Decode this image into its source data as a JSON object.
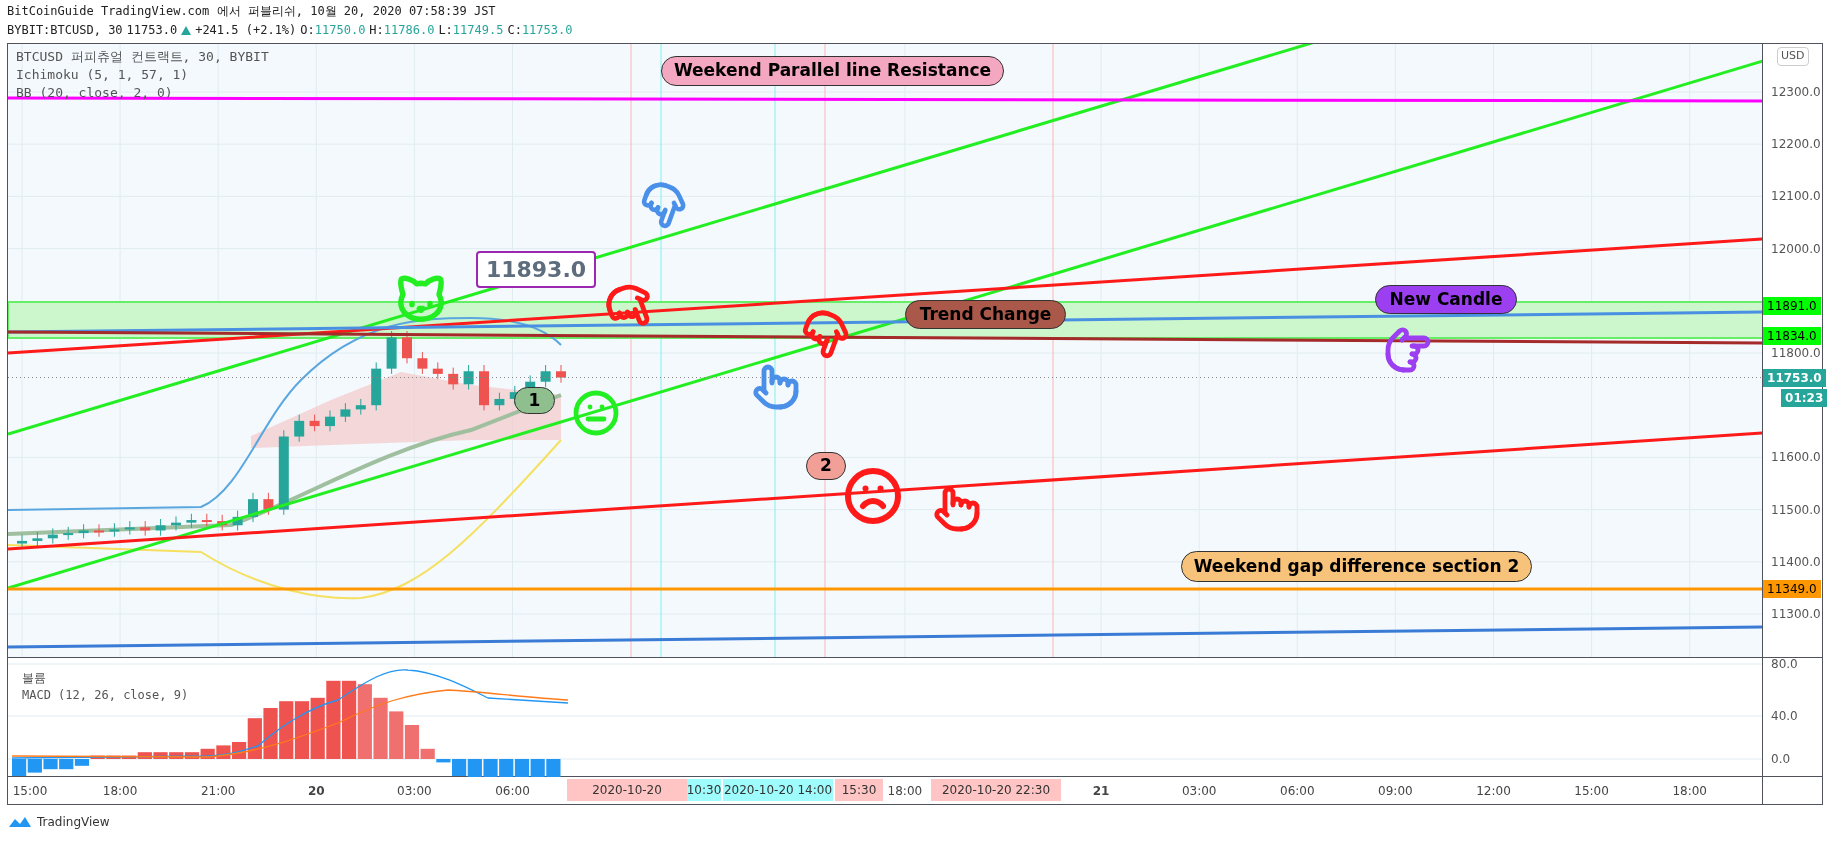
{
  "header": {
    "title": "BitCoinGuide TradingView.com 에서 퍼블리쉬, 10월 20, 2020 07:58:39 JST",
    "symbol": "BYBIT:BTCUSD, 30",
    "last": "11753.0",
    "change_up": true,
    "change": "+241.5 (+2.1%)",
    "ohlc": [
      {
        "label": "O:",
        "value": "11750.0"
      },
      {
        "label": "H:",
        "value": "11786.0"
      },
      {
        "label": "L:",
        "value": "11749.5"
      },
      {
        "label": "C:",
        "value": "11753.0"
      }
    ]
  },
  "legend": [
    "BTCUSD 퍼피츄얼 컨트랙트, 30, BYBIT",
    "Ichimoku (5, 1, 57, 1)",
    "BB (20, close, 2, 0)"
  ],
  "currency": "USD",
  "price_ticks": [
    "12300.0",
    "12200.0",
    "12100.0",
    "12000.0",
    "11800.0",
    "11600.0",
    "11500.0",
    "11400.0",
    "11300.0"
  ],
  "price_labels": [
    {
      "text": "11891.0",
      "color": "#00ff00",
      "kind": "level"
    },
    {
      "text": "11834.0",
      "color": "#00ff00",
      "kind": "level"
    },
    {
      "text": "11753.0",
      "color": "#26a69a",
      "kind": "last"
    },
    {
      "text": "01:23",
      "color": "#26a69a",
      "kind": "countdown"
    },
    {
      "text": "11349.0",
      "color": "#ff9800",
      "kind": "level"
    }
  ],
  "callouts": [
    {
      "text": "Weekend Parallel line Resistance",
      "color": "#f4a7c1",
      "kind": "pill"
    },
    {
      "text": "11893.0",
      "color": "#9c27b0",
      "kind": "box"
    },
    {
      "text": "Trend Change",
      "color": "#a9584a",
      "kind": "pill"
    },
    {
      "text": "New Candle",
      "color": "#9c3ff0",
      "kind": "pill"
    },
    {
      "text": "Weekend gap difference section 2",
      "color": "#f7c279",
      "kind": "pill"
    },
    {
      "text": "1",
      "color": "#8fbf8f",
      "kind": "pill"
    },
    {
      "text": "2",
      "color": "#f2a097",
      "kind": "pill"
    }
  ],
  "macd": {
    "legend": [
      "볼륨",
      "MACD (12, 26, close, 9)"
    ],
    "ticks": [
      "80.0",
      "40.0",
      "0.0"
    ]
  },
  "time_ticks": [
    {
      "text": "15:00",
      "bold": false
    },
    {
      "text": "18:00",
      "bold": false
    },
    {
      "text": "21:00",
      "bold": false
    },
    {
      "text": "20",
      "bold": true
    },
    {
      "text": "03:00",
      "bold": false
    },
    {
      "text": "06:00",
      "bold": false
    },
    {
      "text": "18:00",
      "bold": false
    },
    {
      "text": "21",
      "bold": true
    },
    {
      "text": "03:00",
      "bold": false
    },
    {
      "text": "06:00",
      "bold": false
    },
    {
      "text": "09:00",
      "bold": false
    },
    {
      "text": "12:00",
      "bold": false
    },
    {
      "text": "15:00",
      "bold": false
    },
    {
      "text": "18:00",
      "bold": false
    }
  ],
  "time_marks": [
    {
      "text": "2020-10-20",
      "color": "#ffc4c4"
    },
    {
      "text": "10:30",
      "color": "#9ffcfc"
    },
    {
      "text": "2020-10-20 14:00",
      "color": "#9ffcfc"
    },
    {
      "text": "15:30",
      "color": "#ffc4c4"
    },
    {
      "text": "2020-10-20 22:30",
      "color": "#ffc4c4"
    }
  ],
  "brand": "TradingView"
}
